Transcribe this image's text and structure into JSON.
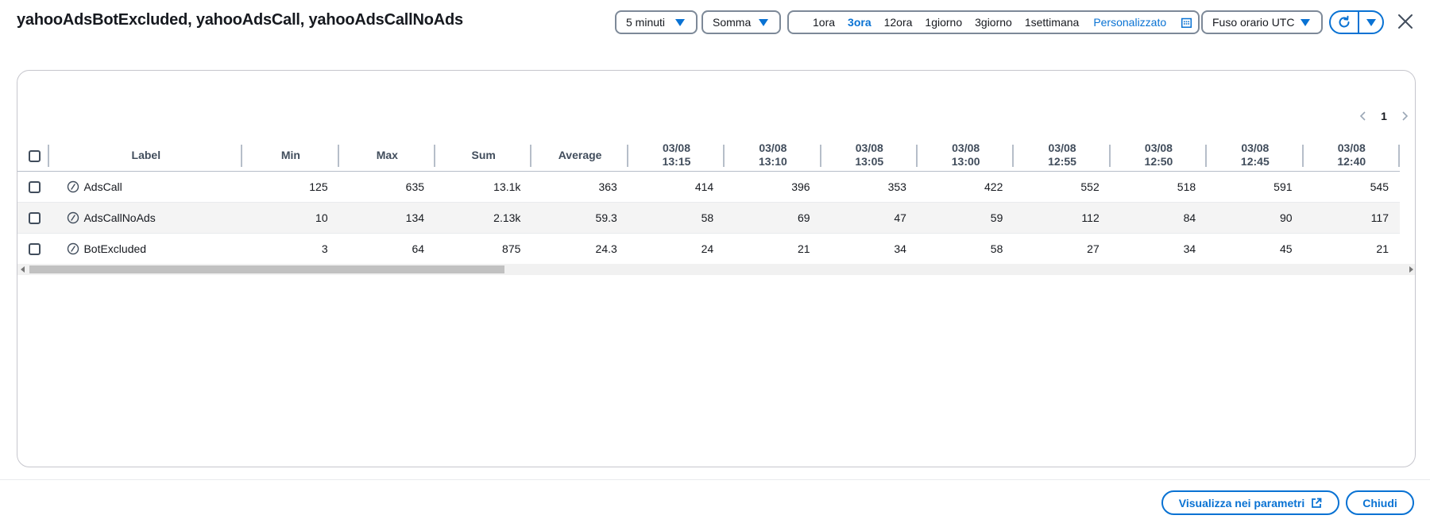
{
  "header": {
    "title": "yahooAdsBotExcluded, yahooAdsCall, yahooAdsCallNoAds",
    "period_value": "5 minuti",
    "statistic_value": "Somma",
    "time_ranges": [
      "1ora",
      "3ora",
      "12ora",
      "1giorno",
      "3giorno",
      "1settimana"
    ],
    "active_range": "3ora",
    "custom_label": "Personalizzato",
    "timezone_value": "Fuso orario UTC"
  },
  "pager": {
    "current_page": "1"
  },
  "table": {
    "columns": [
      "Label",
      "Min",
      "Max",
      "Sum",
      "Average"
    ],
    "time_columns": [
      {
        "date": "03/08",
        "time": "13:15"
      },
      {
        "date": "03/08",
        "time": "13:10"
      },
      {
        "date": "03/08",
        "time": "13:05"
      },
      {
        "date": "03/08",
        "time": "13:00"
      },
      {
        "date": "03/08",
        "time": "12:55"
      },
      {
        "date": "03/08",
        "time": "12:50"
      },
      {
        "date": "03/08",
        "time": "12:45"
      },
      {
        "date": "03/08",
        "time": "12:40"
      }
    ],
    "rows": [
      {
        "label": "AdsCall",
        "min": "125",
        "max": "635",
        "sum": "13.1k",
        "average": "363",
        "values": [
          "414",
          "396",
          "353",
          "422",
          "552",
          "518",
          "591",
          "545"
        ]
      },
      {
        "label": "AdsCallNoAds",
        "min": "10",
        "max": "134",
        "sum": "2.13k",
        "average": "59.3",
        "values": [
          "58",
          "69",
          "47",
          "59",
          "112",
          "84",
          "90",
          "117"
        ]
      },
      {
        "label": "BotExcluded",
        "min": "3",
        "max": "64",
        "sum": "875",
        "average": "24.3",
        "values": [
          "24",
          "21",
          "34",
          "58",
          "27",
          "34",
          "45",
          "21"
        ]
      }
    ]
  },
  "footer": {
    "view_in_metrics_label": "Visualizza nei parametri",
    "close_label": "Chiudi"
  },
  "colors": {
    "accent": "#0972d3",
    "text": "#16191f",
    "border": "#7d8998"
  },
  "icons": {
    "period_caret": "caret-down-icon",
    "refresh": "refresh-icon",
    "calendar": "calendar-icon",
    "close": "close-icon",
    "metric": "metric-icon",
    "external": "external-link-icon"
  }
}
